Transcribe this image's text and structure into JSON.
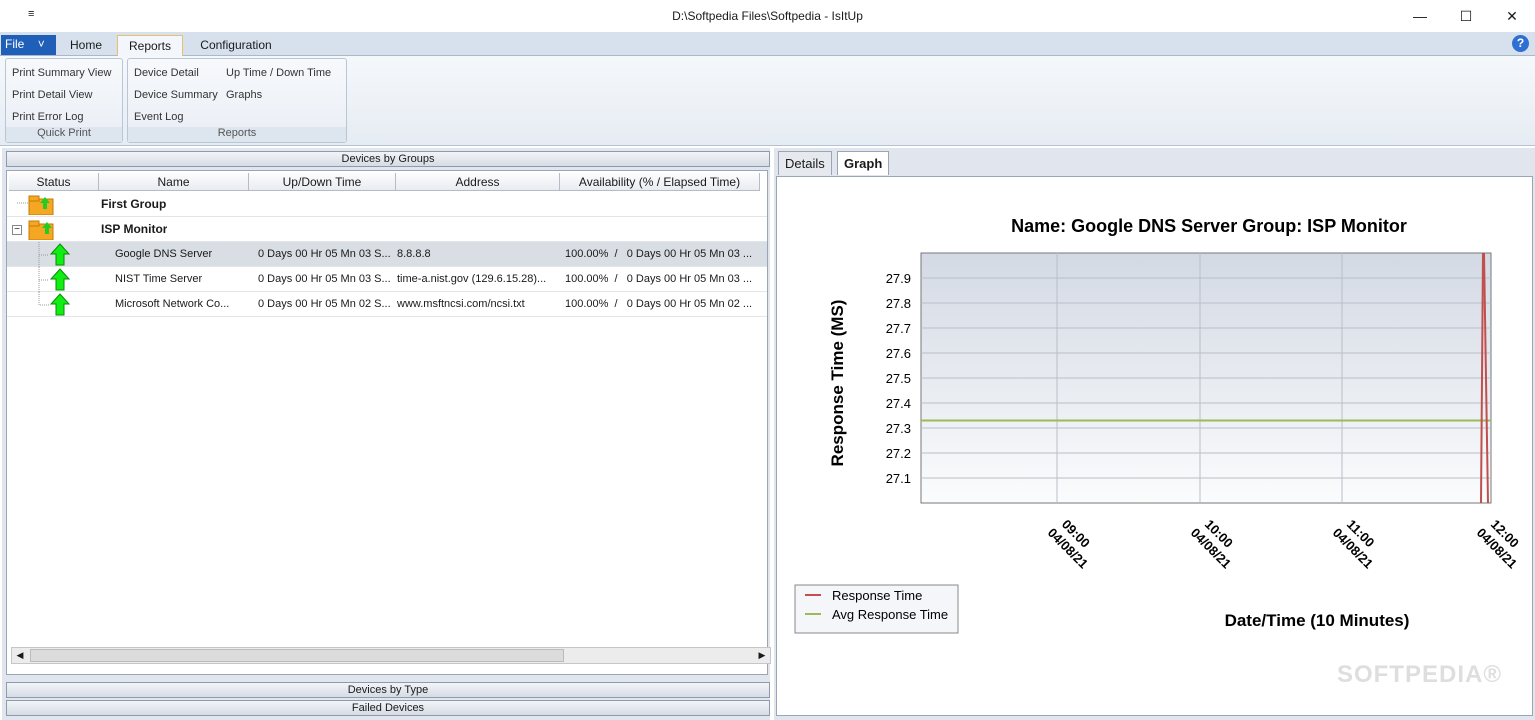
{
  "window": {
    "title": "D:\\Softpedia Files\\Softpedia - IsItUp",
    "qat": "≡",
    "minimize": "—",
    "maximize": "☐",
    "close": "✕"
  },
  "ribbon": {
    "file_label": "File",
    "file_arrow": "˅",
    "tabs": [
      "Home",
      "Reports",
      "Configuration"
    ],
    "help": "?",
    "groups": [
      {
        "label": "Quick Print",
        "items": [
          "Print Summary View",
          "Print Detail View",
          "Print Error Log"
        ]
      },
      {
        "label": "Reports",
        "items": [
          "Device Detail",
          "Device Summary",
          "Event Log",
          "Up Time / Down Time",
          "Graphs"
        ]
      }
    ]
  },
  "left": {
    "devices_by_groups": "Devices by Groups",
    "devices_by_type": "Devices by Type",
    "failed_devices": "Failed Devices",
    "columns": [
      "Status",
      "Name",
      "Up/Down Time",
      "Address",
      "Availability (% / Elapsed Time)"
    ],
    "groups": [
      {
        "name": "First Group"
      },
      {
        "name": "ISP Monitor",
        "expander": "−"
      }
    ],
    "rows": [
      {
        "name": "Google DNS Server",
        "updown": "0 Days 00 Hr 05 Mn 03 S...",
        "address": "8.8.8.8",
        "availability": "100.00%  /   0 Days 00 Hr 05 Mn 03 ..."
      },
      {
        "name": "NIST Time Server",
        "updown": "0 Days 00 Hr 05 Mn 03 S...",
        "address": "time-a.nist.gov (129.6.15.28)...",
        "availability": "100.00%  /   0 Days 00 Hr 05 Mn 03 ..."
      },
      {
        "name": "Microsoft Network Co...",
        "updown": "0 Days 00 Hr 05 Mn 02 S...",
        "address": "www.msftncsi.com/ncsi.txt",
        "availability": "100.00%  /   0 Days 00 Hr 05 Mn 02 ..."
      }
    ],
    "scroll_left": "◀",
    "scroll_right": "▶"
  },
  "right": {
    "tabs": [
      "Details",
      "Graph"
    ],
    "watermark": "SOFTPEDIA®"
  },
  "chart_data": {
    "type": "line",
    "title": "Name: Google DNS Server  Group: ISP Monitor",
    "xlabel": "Date/Time (10 Minutes)",
    "ylabel": "Response Time (MS)",
    "yticks": [
      "27.1",
      "27.2",
      "27.3",
      "27.4",
      "27.5",
      "27.6",
      "27.7",
      "27.8",
      "27.9"
    ],
    "ylim": [
      27.0,
      28.0
    ],
    "xticks": [
      {
        "time": "09:00",
        "date": "04/08/21"
      },
      {
        "time": "10:00",
        "date": "04/08/21"
      },
      {
        "time": "11:00",
        "date": "04/08/21"
      },
      {
        "time": "12:00",
        "date": "04/08/21"
      }
    ],
    "series": [
      {
        "name": "Response Time",
        "color": "#c0504d"
      },
      {
        "name": "Avg Response Time",
        "value": 27.33,
        "color": "#9bbb59"
      }
    ],
    "legend_position": "bottom-left",
    "grid": true
  }
}
